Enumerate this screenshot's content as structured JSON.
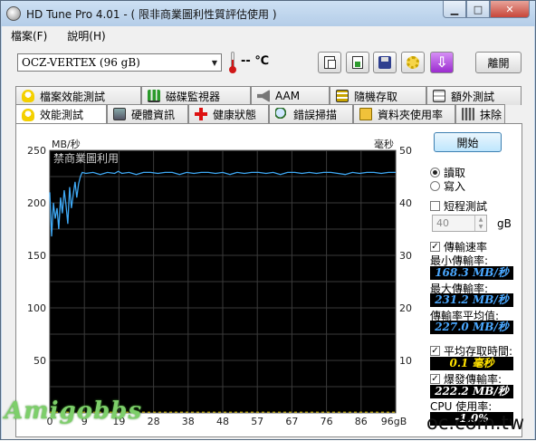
{
  "window": {
    "title": "HD Tune Pro 4.01 - ( 限非商業圖利性質評估使用 )",
    "controls": [
      "minimize",
      "maximize",
      "close"
    ]
  },
  "menu": [
    "檔案(F)",
    "說明(H)"
  ],
  "toolbar": {
    "drive": "OCZ-VERTEX (96 gB)",
    "temperature": "-- ℃",
    "icons": [
      "copy-text-icon",
      "copy-screenshot-icon",
      "save-icon",
      "options-icon",
      "exit-down-icon"
    ],
    "exit_label": "離開"
  },
  "tabs": {
    "row1": [
      {
        "label": "檔案效能測試",
        "icon": "file-benchmark-icon"
      },
      {
        "label": "磁碟監視器",
        "icon": "disk-monitor-icon"
      },
      {
        "label": "AAM",
        "icon": "speaker-icon"
      },
      {
        "label": "隨機存取",
        "icon": "random-access-icon"
      },
      {
        "label": "額外測試",
        "icon": "extra-tests-icon"
      }
    ],
    "row2": [
      {
        "label": "效能測試",
        "icon": "benchmark-bulb-icon",
        "active": true
      },
      {
        "label": "硬體資訊",
        "icon": "info-icon"
      },
      {
        "label": "健康狀態",
        "icon": "health-cross-icon"
      },
      {
        "label": "錯誤掃描",
        "icon": "error-scan-icon"
      },
      {
        "label": "資料夾使用率",
        "icon": "folder-usage-icon"
      },
      {
        "label": "抹除",
        "icon": "erase-trash-icon"
      }
    ]
  },
  "chart_data": {
    "type": "line",
    "left_axis_label": "MB/秒",
    "right_axis_label": "毫秒",
    "left_ticks": [
      250,
      200,
      150,
      100,
      50
    ],
    "right_ticks": [
      50,
      40,
      30,
      20,
      10
    ],
    "x_ticks": [
      "0",
      "9",
      "19",
      "28",
      "38",
      "48",
      "57",
      "67",
      "76",
      "86",
      "96gB"
    ],
    "ylim": [
      0,
      250
    ],
    "y2lim": [
      0,
      50
    ],
    "xlim": [
      0,
      96
    ],
    "background_note": "禁商業圖利用",
    "grid": true,
    "series": [
      {
        "color": "#3fa9f5",
        "x": [
          0,
          0.5,
          1,
          1.5,
          2,
          2.5,
          3,
          3.5,
          4,
          4.5,
          5,
          5.5,
          6,
          6.5,
          7,
          7.5,
          8,
          8.5,
          9,
          10,
          12,
          14,
          16,
          18,
          19,
          20,
          22,
          24,
          26,
          28,
          30,
          32,
          34,
          36,
          38,
          40,
          42,
          44,
          46,
          48,
          50,
          52,
          54,
          56,
          58,
          60,
          62,
          64,
          66,
          68,
          70,
          72,
          74,
          76,
          78,
          80,
          82,
          84,
          86,
          88,
          90,
          92,
          94,
          96
        ],
        "y": [
          210,
          168,
          200,
          185,
          195,
          175,
          205,
          190,
          212,
          198,
          180,
          215,
          195,
          208,
          220,
          205,
          218,
          225,
          229,
          228,
          229,
          227,
          229,
          228,
          230,
          228,
          229,
          227,
          229,
          229,
          228,
          229,
          229,
          227,
          229,
          228,
          229,
          229,
          228,
          229,
          227,
          229,
          228,
          229,
          229,
          228,
          229,
          227,
          229,
          229,
          228,
          229,
          228,
          229,
          229,
          228,
          227,
          229,
          228,
          229,
          229,
          228,
          229,
          229
        ]
      }
    ]
  },
  "watermark": "Amigobbs",
  "site_text": "oc.com.tw",
  "controls": {
    "start_label": "開始",
    "read_label": "讀取",
    "write_label": "寫入",
    "short_test_label": "短程測試",
    "short_test_value": "40",
    "gb_label": "gB",
    "transfer_rate_label": "傳輸速率",
    "min_rate_label": "最小傳輸率:",
    "min_rate_value": "168.3 MB/秒",
    "max_rate_label": "最大傳輸率:",
    "max_rate_value": "231.2 MB/秒",
    "avg_rate_label": "傳輸率平均值:",
    "avg_rate_value": "227.0 MB/秒",
    "access_time_label": "平均存取時間:",
    "access_time_value": "0.1 毫秒",
    "burst_rate_label": "爆發傳輸率:",
    "burst_rate_value": "222.2 MB/秒",
    "cpu_label": "CPU 使用率:",
    "cpu_value": "-1.0%"
  }
}
